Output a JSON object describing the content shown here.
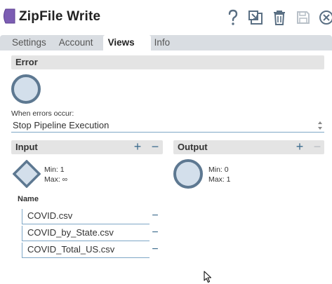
{
  "window": {
    "title": "ZipFile Write",
    "accent_color": "#7c5db3"
  },
  "toolbar": {
    "help_icon": "question-mark-icon",
    "save_label_icon": "save-icon",
    "delete_icon": "trash-icon",
    "export_icon": "export-icon",
    "close_icon": "close-icon"
  },
  "tabs": [
    {
      "label": "Settings"
    },
    {
      "label": "Account"
    },
    {
      "label": "Views"
    },
    {
      "label": "Info"
    }
  ],
  "active_tab": "Views",
  "error_section": {
    "title": "Error",
    "when_errors_label": "When errors occur:",
    "selected_option": "Stop Pipeline Execution"
  },
  "input_section": {
    "title": "Input",
    "min": "Min: 1",
    "max": "Max: ∞",
    "add_label": "+",
    "remove_label": "−",
    "name_header": "Name",
    "files": [
      {
        "name": "COVID.csv"
      },
      {
        "name": "COVID_by_State.csv"
      },
      {
        "name": "COVID_Total_US.csv"
      }
    ]
  },
  "output_section": {
    "title": "Output",
    "min": "Min: 0",
    "max": "Max: 1",
    "add_label": "+",
    "remove_label": "−"
  },
  "colors": {
    "node_fill": "#d3dfeb",
    "node_stroke": "#5d7891",
    "link_blue": "#3d6c8e",
    "section_bg": "#e4e4e4",
    "tabs_bg": "#d9dde2"
  }
}
